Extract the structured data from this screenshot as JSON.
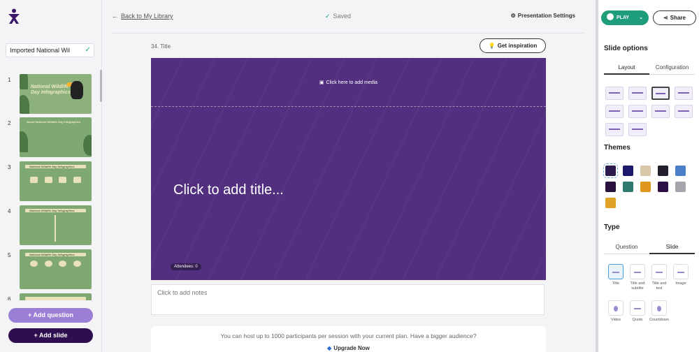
{
  "app": {
    "presentation_name": "Imported National Wil"
  },
  "topbar": {
    "back_label": "Back to My Library",
    "saved_label": "Saved",
    "settings_label": "Presentation Settings"
  },
  "sidebar": {
    "slides": [
      {
        "number": "1",
        "caption": "National Wildlife Day Infographics"
      },
      {
        "number": "2",
        "caption": "About National Wildlife Day Infographics"
      },
      {
        "number": "3",
        "caption": "National Wildlife Day Infographics"
      },
      {
        "number": "4",
        "caption": "National Wildlife Day Infographics"
      },
      {
        "number": "5",
        "caption": "National Wildlife Day Infographics"
      },
      {
        "number": "6",
        "caption": ""
      }
    ],
    "add_question_label": "+ Add question",
    "add_slide_label": "+ Add slide"
  },
  "editor": {
    "slide_label": "34. Title",
    "inspiration_label": "Get inspiration",
    "media_placeholder": "Click here to add media",
    "title_placeholder": "Click to add title...",
    "attendees_label": "Attendees: 0",
    "notes_placeholder": "Click to add notes",
    "plan_message": "You can host up to 1000 participants per session with your current plan. Have a bigger audience?",
    "upgrade_label": "Upgrade Now"
  },
  "right_panel": {
    "play_label": "PLAY",
    "share_label": "Share",
    "slide_options_heading": "Slide options",
    "layout_tabs": [
      "Layout",
      "Configuration"
    ],
    "themes_heading": "Themes",
    "theme_colors": [
      "#2b1a4d",
      "#1e1a6b",
      "#d9c9a8",
      "#231d2d",
      "#4a7fc8",
      "#2a1240",
      "#2f7a6f",
      "#e0961e",
      "#2b0f45",
      "#a8a6ad",
      "#e0a227"
    ],
    "type_heading": "Type",
    "type_tabs": [
      "Question",
      "Slide"
    ],
    "types": [
      "Title",
      "Title and subtitle",
      "Title and text",
      "Image",
      "Video",
      "Quote",
      "Countdown"
    ]
  },
  "colors": {
    "slide_bg": "#52307f",
    "accent": "#1f9c7a",
    "brand": "#2e0e4e"
  }
}
